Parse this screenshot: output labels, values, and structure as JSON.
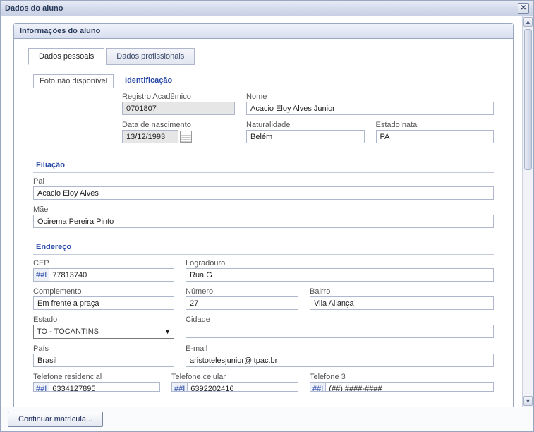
{
  "window": {
    "title": "Dados do aluno"
  },
  "panel": {
    "title": "Informações do aluno"
  },
  "tabs": {
    "personal": "Dados pessoais",
    "professional": "Dados profissionais"
  },
  "photo_placeholder": "Foto não disponível",
  "sections": {
    "ident": "Identificação",
    "filiacao": "Filiação",
    "endereco": "Endereço"
  },
  "labels": {
    "registro": "Registro Acadêmico",
    "nome": "Nome",
    "data_nasc": "Data de nascimento",
    "naturalidade": "Naturalidade",
    "estado_natal": "Estado natal",
    "pai": "Pai",
    "mae": "Mãe",
    "cep": "CEP",
    "logradouro": "Logradouro",
    "complemento": "Complemento",
    "numero": "Número",
    "bairro": "Bairro",
    "estado": "Estado",
    "cidade": "Cidade",
    "pais": "País",
    "email": "E-mail",
    "tel_res": "Telefone residencial",
    "tel_cel": "Telefone celular",
    "tel3": "Telefone 3"
  },
  "values": {
    "registro": "0701807",
    "nome": "Acacio Eloy Alves Junior",
    "data_nasc": "13/12/1993",
    "naturalidade": "Belém",
    "estado_natal": "PA",
    "pai": "Acacio Eloy Alves",
    "mae": "Ocirema Pereira Pinto",
    "cep_prefix": "##I",
    "cep": "77813740",
    "logradouro": "Rua G",
    "complemento": "Em frente a praça",
    "numero": "27",
    "bairro": "Vila Aliança",
    "estado": "TO - TOCANTINS",
    "cidade": "",
    "pais": "Brasil",
    "email": "aristotelesjunior@itpac.br",
    "tel_prefix": "##I",
    "tel_res": "6334127895",
    "tel_cel": "6392202416",
    "tel3_prefix": "##I",
    "tel3": "(##) ####-####"
  },
  "footer": {
    "continue": "Continuar matrícula..."
  }
}
